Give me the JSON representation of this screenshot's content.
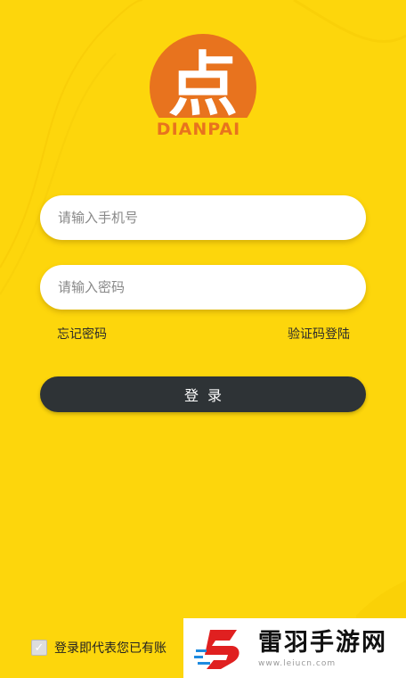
{
  "colors": {
    "background": "#FDD60C",
    "button": "#2E3336",
    "logo": "#E8731E"
  },
  "logo": {
    "glyph": "点",
    "caption": "DIANPAI"
  },
  "form": {
    "phone_placeholder": "请输入手机号",
    "password_placeholder": "请输入密码",
    "forgot_label": "忘记密码",
    "sms_login_label": "验证码登陆",
    "login_label": "登录"
  },
  "agreement": {
    "text": "登录即代表您已有账",
    "checked": true
  },
  "watermark": {
    "title": "雷羽手游网",
    "url": "www.leiucn.com"
  }
}
